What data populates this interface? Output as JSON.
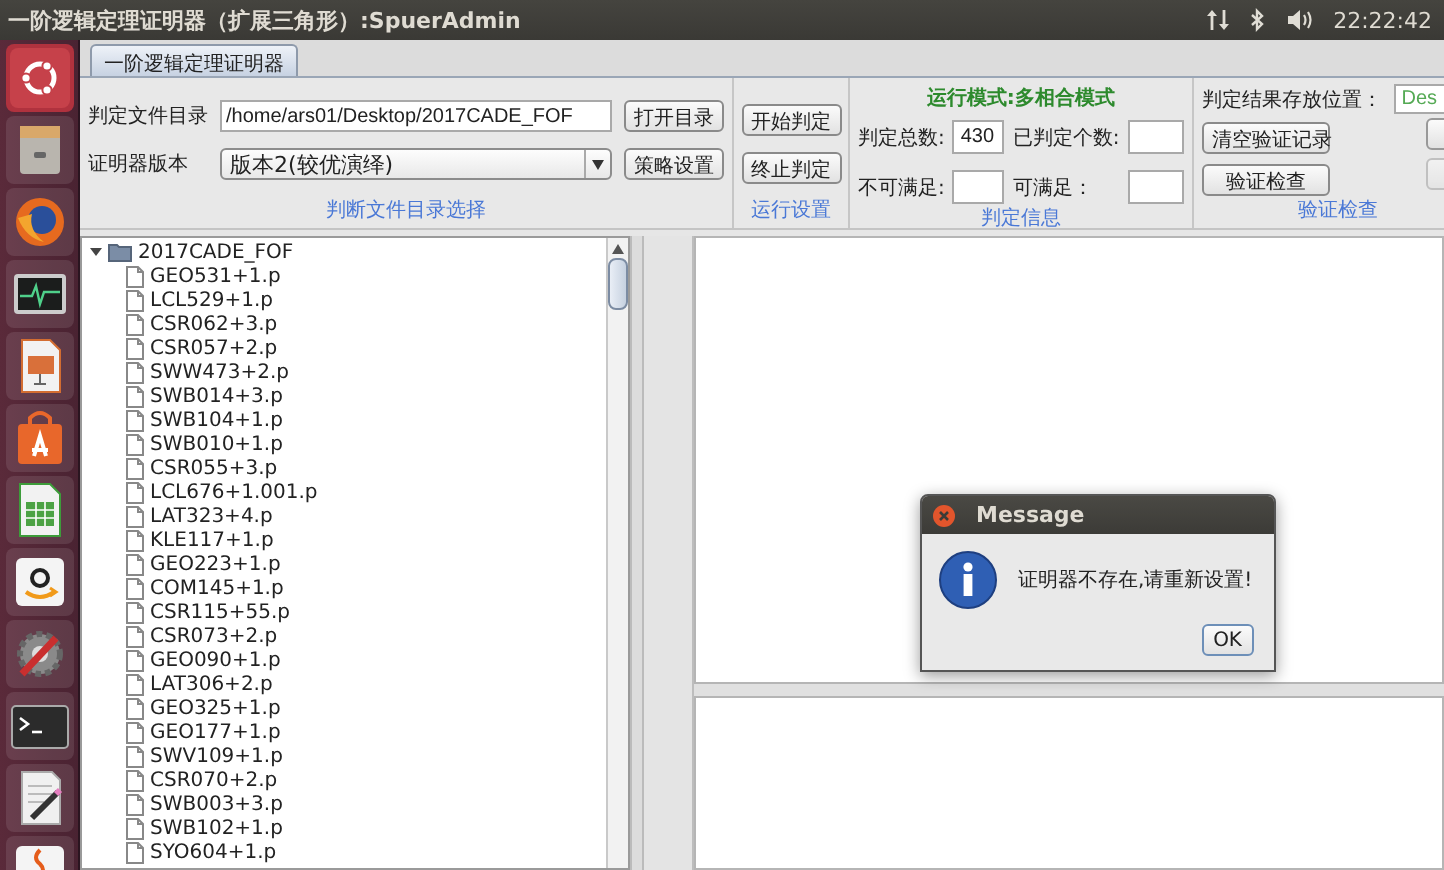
{
  "top_bar": {
    "title": "一阶逻辑定理证明器（扩展三角形）:SpuerAdmin",
    "clock": "22:22:42"
  },
  "tabs": [
    {
      "label": "一阶逻辑定理证明器",
      "selected": true
    }
  ],
  "file_section": {
    "dir_label": "判定文件目录",
    "dir_value": "/home/ars01/Desktop/2017CADE_FOF",
    "open_button": "打开目录",
    "version_label": "证明器版本",
    "version_value": "版本2(较优演绎)",
    "strategy_button": "策略设置",
    "caption": "判断文件目录选择"
  },
  "run_section": {
    "start_button": "开始判定",
    "stop_button": "终止判定",
    "caption": "运行设置"
  },
  "info_section": {
    "mode": "运行模式:多相合模式",
    "fields": [
      {
        "label": "判定总数:",
        "value": "430"
      },
      {
        "label": "已判定个数:"
      },
      {
        "label": "不可满足:"
      },
      {
        "label": "可满足："
      }
    ],
    "caption": "判定信息"
  },
  "verify_section": {
    "location_label": "判定结果存放位置：",
    "location_value": "Des",
    "clear_button": "清空验证记录",
    "check_button": "验证检查",
    "caption": "验证检查"
  },
  "tree": {
    "root": {
      "label": "2017CADE_FOF",
      "expanded": true,
      "children": [
        {
          "label": "GEO531+1.p"
        },
        {
          "label": "LCL529+1.p"
        },
        {
          "label": "CSR062+3.p"
        },
        {
          "label": "CSR057+2.p"
        },
        {
          "label": "SWW473+2.p"
        },
        {
          "label": "SWB014+3.p"
        },
        {
          "label": "SWB104+1.p"
        },
        {
          "label": "SWB010+1.p"
        },
        {
          "label": "CSR055+3.p"
        },
        {
          "label": "LCL676+1.001.p"
        },
        {
          "label": "LAT323+4.p"
        },
        {
          "label": "KLE117+1.p"
        },
        {
          "label": "GEO223+1.p"
        },
        {
          "label": "COM145+1.p"
        },
        {
          "label": "CSR115+55.p"
        },
        {
          "label": "CSR073+2.p"
        },
        {
          "label": "GEO090+1.p"
        },
        {
          "label": "LAT306+2.p"
        },
        {
          "label": "GEO325+1.p"
        },
        {
          "label": "GEO177+1.p"
        },
        {
          "label": "SWV109+1.p"
        },
        {
          "label": "CSR070+2.p"
        },
        {
          "label": "SWB003+3.p"
        },
        {
          "label": "SWB102+1.p"
        },
        {
          "label": "SYO604+1.p"
        }
      ]
    }
  },
  "dialog": {
    "title": "Message",
    "message": "证明器不存在,请重新设置!",
    "ok_button": "OK"
  }
}
